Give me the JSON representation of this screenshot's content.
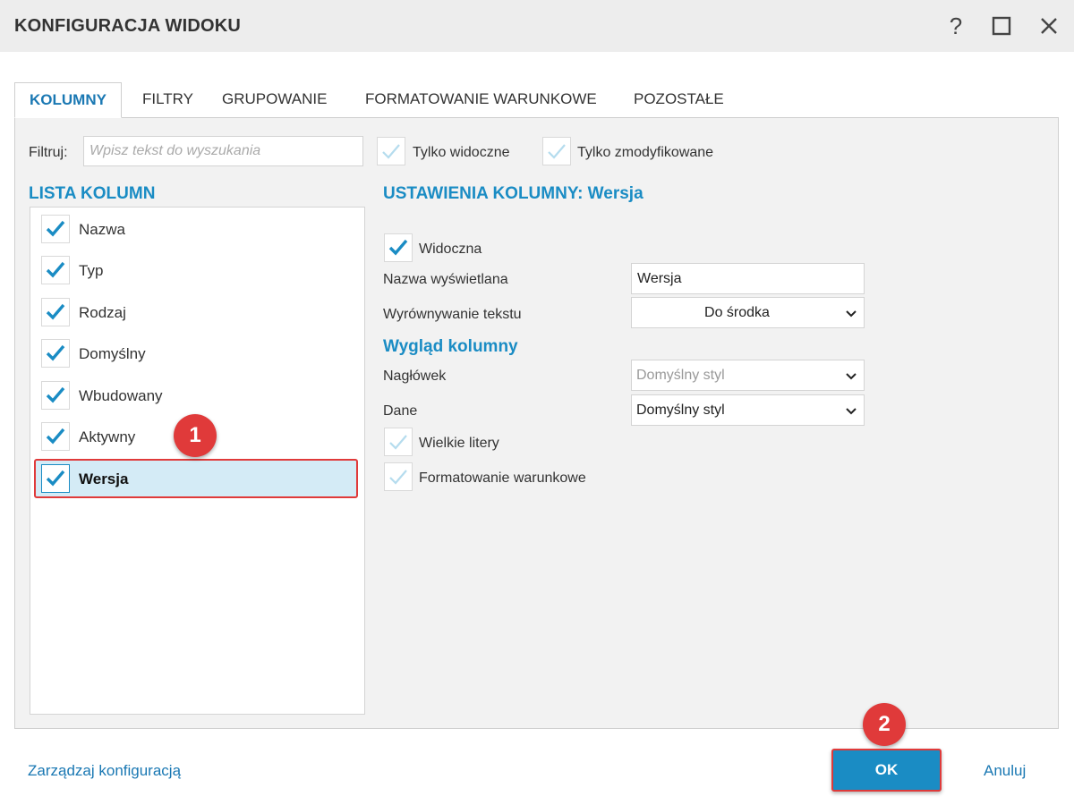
{
  "window": {
    "title": "KONFIGURACJA WIDOKU",
    "help_glyph": "?",
    "maximize_glyph": "☐",
    "close_glyph": "✕"
  },
  "tabs": [
    {
      "label": "KOLUMNY",
      "active": true
    },
    {
      "label": "FILTRY",
      "active": false
    },
    {
      "label": "GRUPOWANIE",
      "active": false
    },
    {
      "label": "FORMATOWANIE WARUNKOWE",
      "active": false
    },
    {
      "label": "POZOSTAŁE",
      "active": false
    }
  ],
  "filter": {
    "label": "Filtruj:",
    "placeholder": "Wpisz tekst do wyszukania",
    "only_visible": {
      "label": "Tylko widoczne",
      "checked": false
    },
    "only_modified": {
      "label": "Tylko zmodyfikowane",
      "checked": false
    }
  },
  "column_list": {
    "title": "LISTA KOLUMN",
    "items": [
      {
        "label": "Nazwa",
        "checked": true
      },
      {
        "label": "Typ",
        "checked": true
      },
      {
        "label": "Rodzaj",
        "checked": true
      },
      {
        "label": "Domyślny",
        "checked": true
      },
      {
        "label": "Wbudowany",
        "checked": true
      },
      {
        "label": "Aktywny",
        "checked": true
      },
      {
        "label": "Wersja",
        "checked": true,
        "selected": true
      }
    ]
  },
  "settings": {
    "title": "USTAWIENIA KOLUMNY: Wersja",
    "visible": {
      "label": "Widoczna",
      "checked": true
    },
    "display_name": {
      "label": "Nazwa wyświetlana",
      "value": "Wersja"
    },
    "alignment": {
      "label": "Wyrównywanie tekstu",
      "value": "Do środka"
    },
    "appearance_title": "Wygląd kolumny",
    "header": {
      "label": "Nagłówek",
      "value": "Domyślny styl"
    },
    "data": {
      "label": "Dane",
      "value": "Domyślny styl"
    },
    "uppercase": {
      "label": "Wielkie litery",
      "checked": false
    },
    "conditional": {
      "label": "Formatowanie warunkowe",
      "checked": false
    }
  },
  "annotations": {
    "badge1": "1",
    "badge2": "2"
  },
  "footer": {
    "manage_link": "Zarządzaj konfiguracją",
    "ok_label": "OK",
    "cancel_label": "Anuluj"
  },
  "colors": {
    "accent": "#1a8cc4",
    "highlight": "#e03a3a",
    "selected_row": "#d4ebf6",
    "panel_bg": "#f2f2f2"
  }
}
